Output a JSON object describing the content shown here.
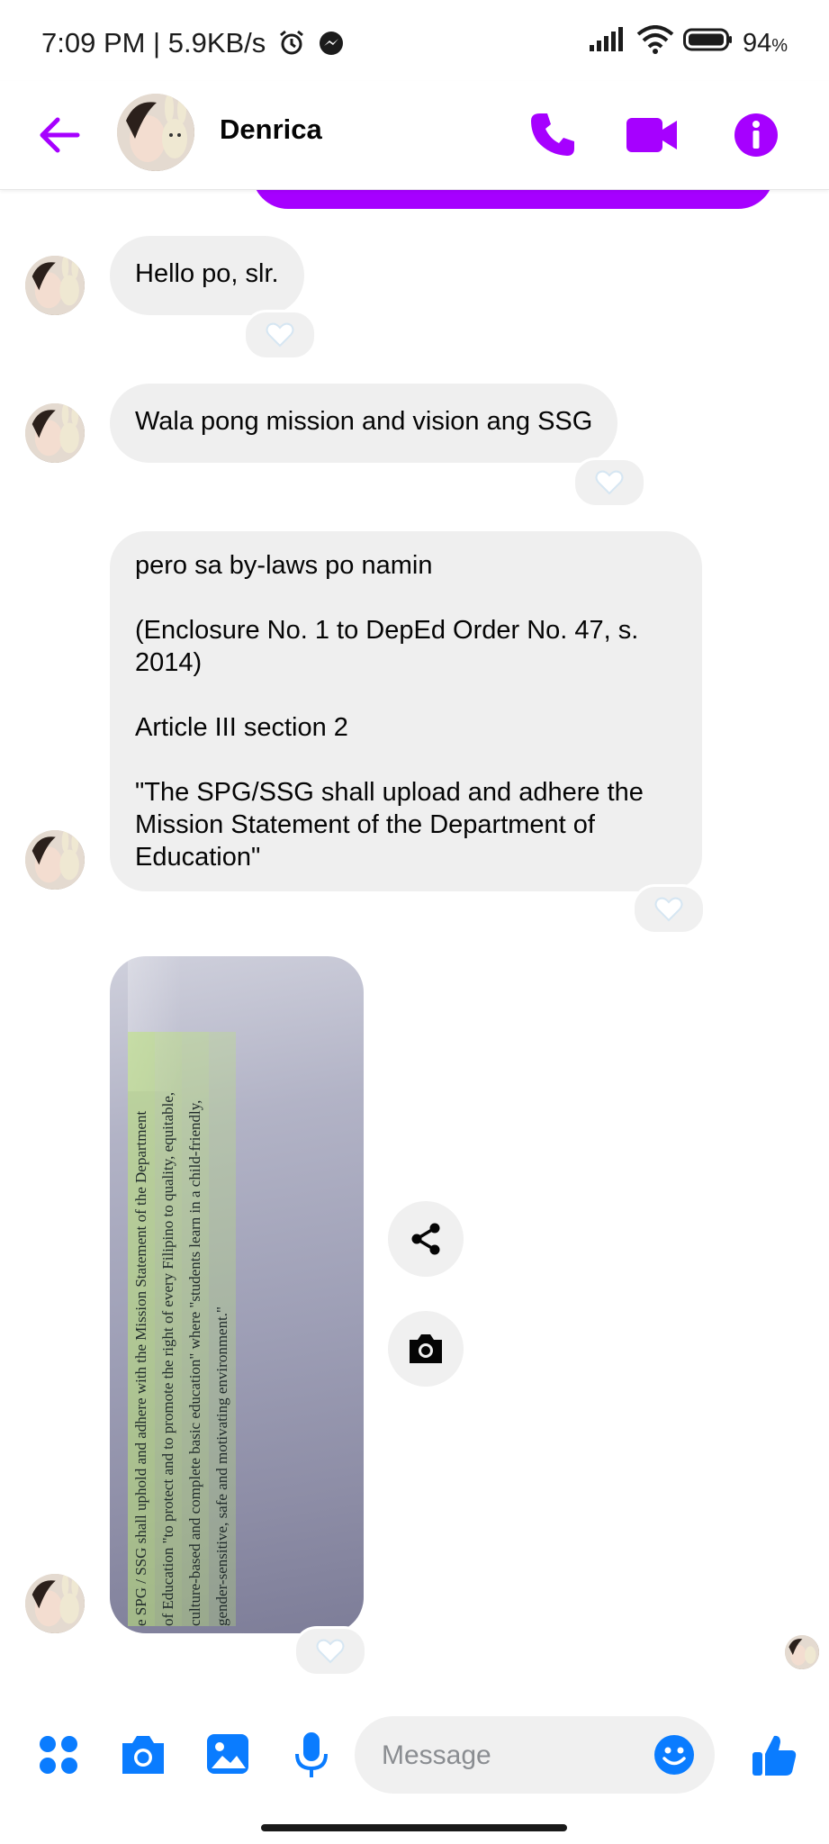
{
  "status_bar": {
    "time_speed": "7:09 PM | 5.9KB/s",
    "battery": "94",
    "battery_unit": "%",
    "icons": [
      "alarm-icon",
      "messenger-icon",
      "signal-icon",
      "wifi-icon",
      "battery-icon"
    ]
  },
  "header": {
    "contact_name": "Denrica",
    "icons": [
      "back-arrow-icon",
      "phone-icon",
      "video-camera-icon",
      "info-icon"
    ]
  },
  "colors": {
    "accent": "#a600ff",
    "composer_blue": "#0a7cff",
    "bubble_gray": "#efefef"
  },
  "messages": [
    {
      "text": "Hello po, slr."
    },
    {
      "text": "Wala pong mission and vision ang SSG"
    },
    {
      "lines": [
        "pero sa by-laws po namin",
        "(Enclosure No. 1 to DepEd Order No. 47, s. 2014)",
        "Article III section 2",
        "\"The SPG/SSG shall upload and adhere the Mission Statement of the Department of Education\""
      ]
    }
  ],
  "photo": {
    "text_lines": [
      "e SPG / SSG shall uphold and adhere with the Mission Statement of the Department",
      "of Education \"to protect and to promote the right of every Filipino to quality, equitable,",
      "culture-based and complete basic education\" where \"students learn in a child-friendly,",
      "gender-sensitive, safe and motivating environment.\""
    ]
  },
  "composer": {
    "placeholder": "Message",
    "icons": [
      "apps-icon",
      "camera-icon",
      "gallery-icon",
      "microphone-icon",
      "emoji-icon",
      "like-icon"
    ]
  }
}
